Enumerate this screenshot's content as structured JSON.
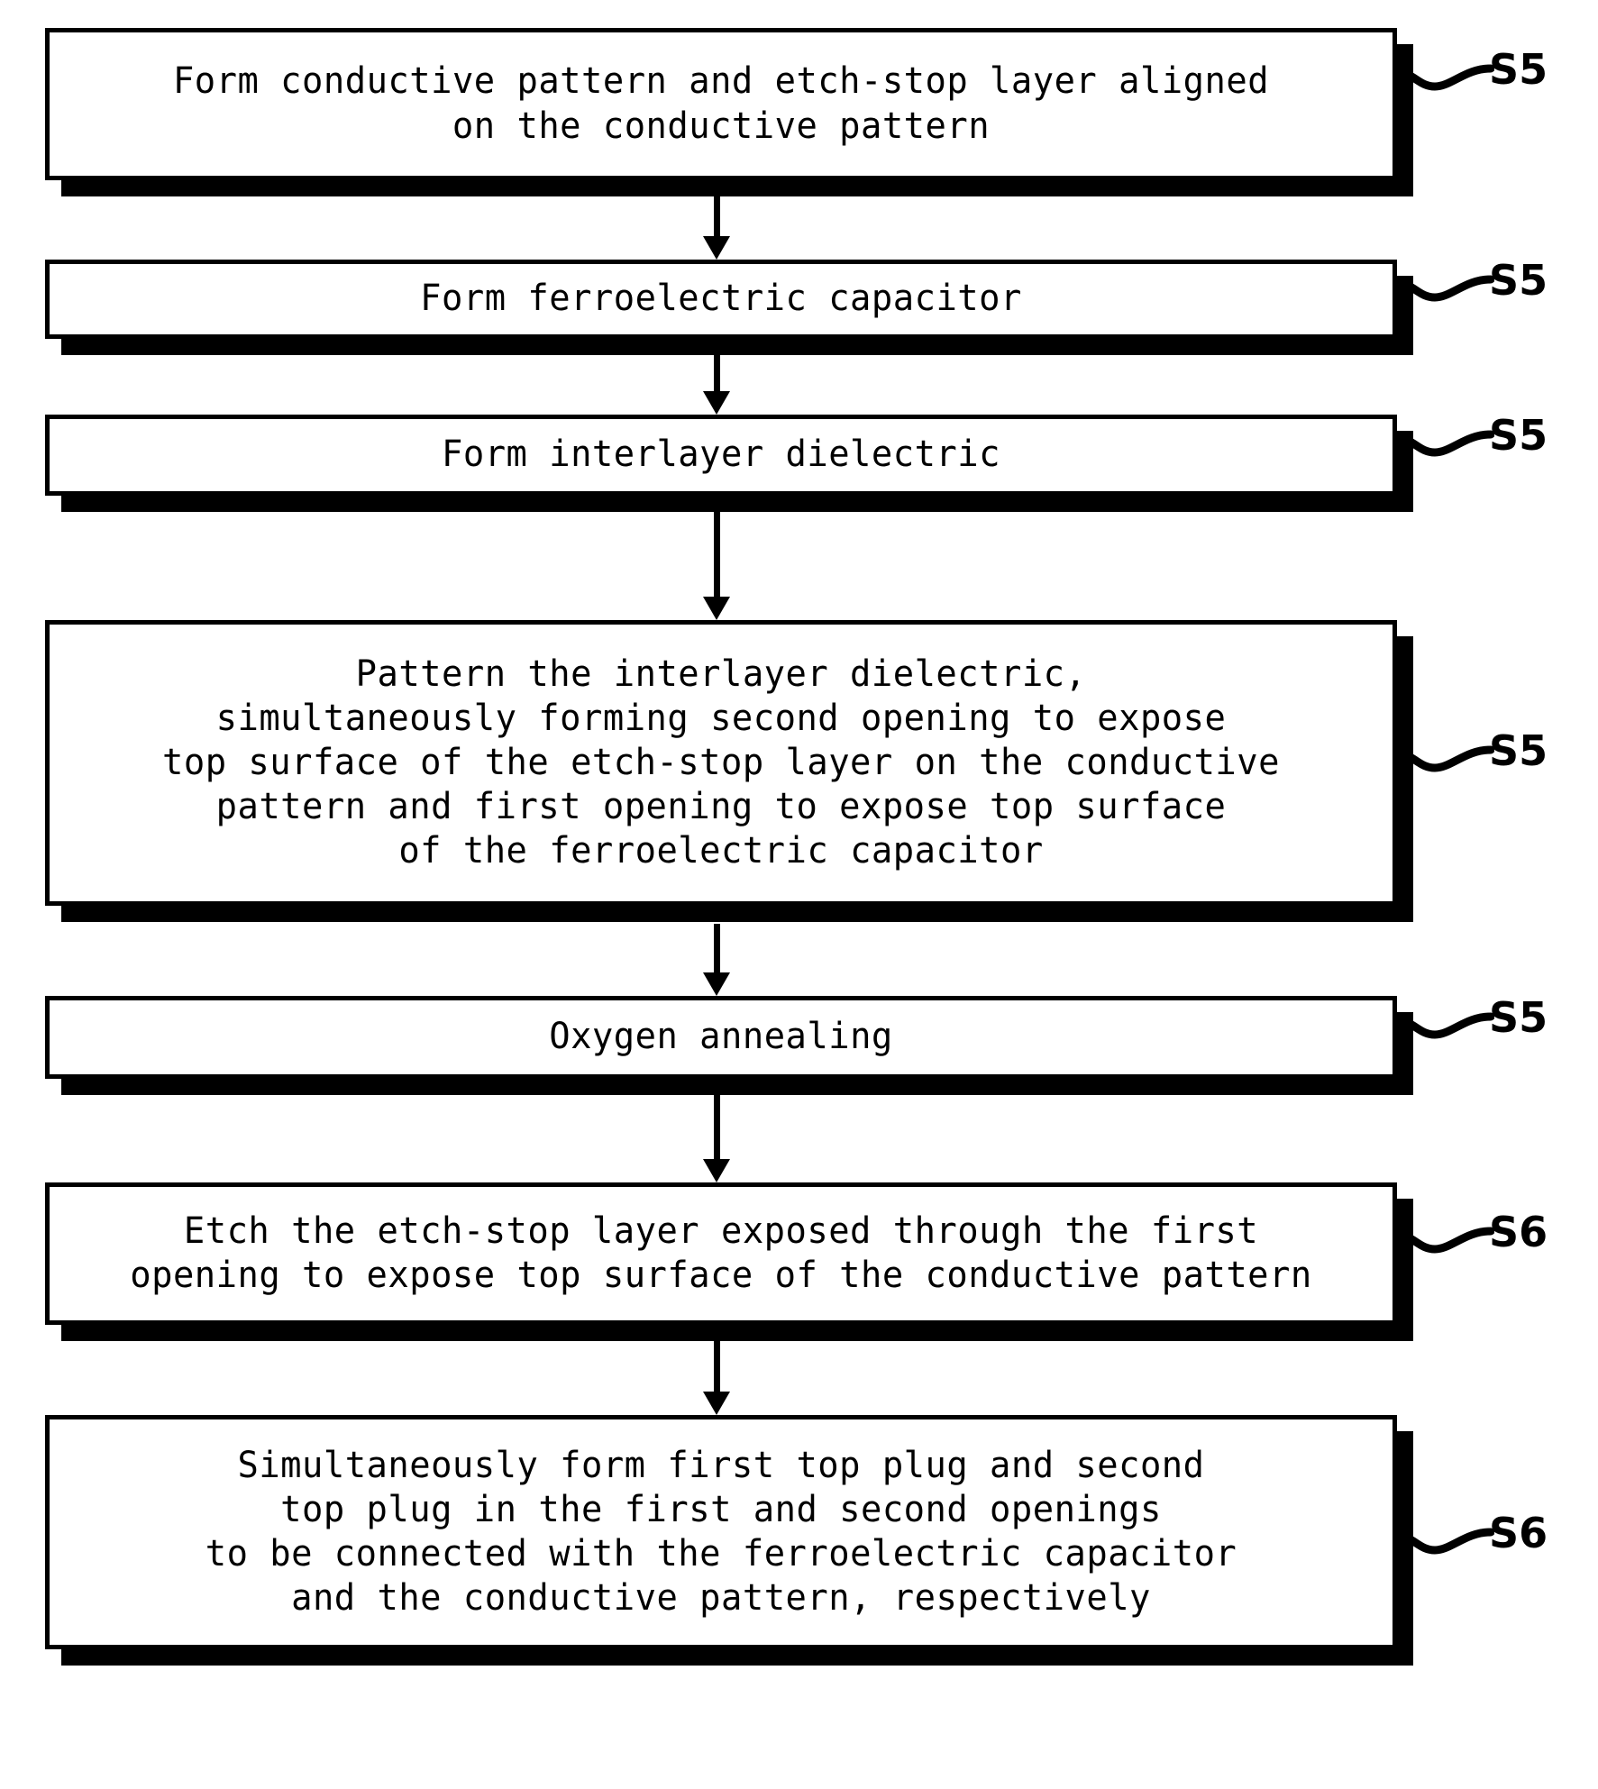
{
  "diagram": {
    "title": "Semiconductor ferroelectric capacitor fabrication process flowchart",
    "background_color": "#ffffff",
    "line_color": "#000000",
    "steps": [
      {
        "id": "step-1",
        "text": "Form conductive pattern and etch-stop layer aligned\non the conductive pattern",
        "label": "S5"
      },
      {
        "id": "step-2",
        "text": "Form ferroelectric capacitor",
        "label": "S5"
      },
      {
        "id": "step-3",
        "text": "Form interlayer dielectric",
        "label": "S5"
      },
      {
        "id": "step-4",
        "text": "Pattern the interlayer dielectric,\nsimultaneously forming second opening to expose\ntop surface of the etch-stop layer on the conductive\npattern and first opening to expose top surface\nof the ferroelectric capacitor",
        "label": "S5"
      },
      {
        "id": "step-5",
        "text": "Oxygen annealing",
        "label": "S5"
      },
      {
        "id": "step-6",
        "text": "Etch the etch-stop layer exposed through the first\nopening to expose top surface of the conductive pattern",
        "label": "S6"
      },
      {
        "id": "step-7",
        "text": "Simultaneously form first top plug and second\ntop plug in the first and second openings\nto be connected with the ferroelectric capacitor\nand the conductive pattern, respectively",
        "label": "S6"
      }
    ]
  }
}
